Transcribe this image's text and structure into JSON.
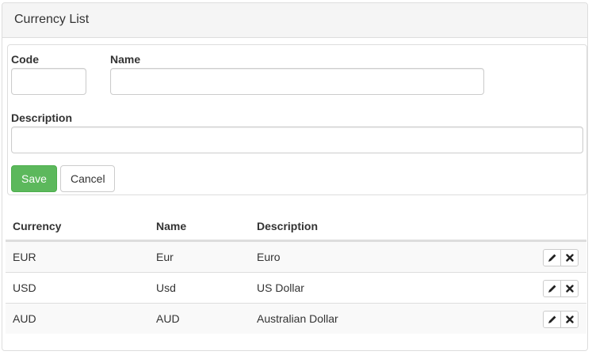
{
  "panel": {
    "title": "Currency List"
  },
  "form": {
    "code_label": "Code",
    "name_label": "Name",
    "description_label": "Description",
    "code_value": "",
    "name_value": "",
    "description_value": "",
    "save_label": "Save",
    "cancel_label": "Cancel"
  },
  "table": {
    "headers": [
      "Currency",
      "Name",
      "Description"
    ],
    "rows": [
      {
        "currency": "EUR",
        "name": "Eur",
        "description": "Euro"
      },
      {
        "currency": "USD",
        "name": "Usd",
        "description": "US Dollar"
      },
      {
        "currency": "AUD",
        "name": "AUD",
        "description": "Australian Dollar"
      }
    ],
    "row_actions": [
      {
        "icon": "pencil-icon"
      },
      {
        "icon": "remove-icon"
      }
    ]
  },
  "colors": {
    "save_button": "#5cb85c",
    "heading_bg": "#f5f5f5",
    "stripe": "#f9f9f9",
    "border": "#dddddd"
  }
}
